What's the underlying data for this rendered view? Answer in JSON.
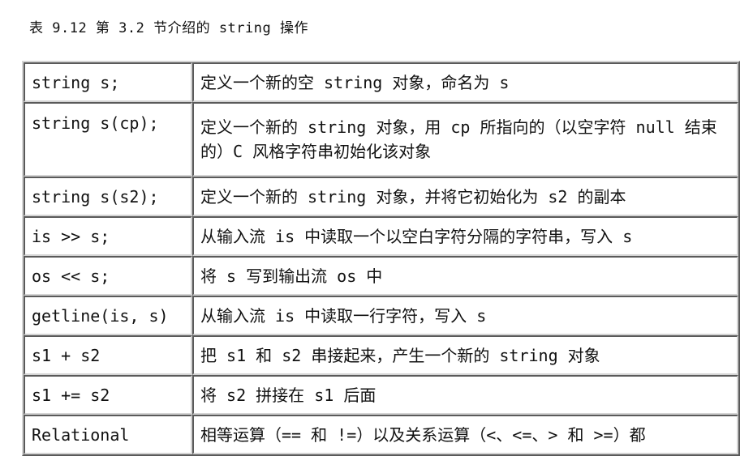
{
  "caption": "表 9.12 第 3.2 节介绍的 string 操作",
  "rows": [
    {
      "op": "string s;",
      "desc": "定义一个新的空 string 对象，命名为 s"
    },
    {
      "op": "string s(cp);",
      "desc": "定义一个新的 string 对象，用 cp 所指向的（以空字符 null 结束的）C 风格字符串初始化该对象"
    },
    {
      "op": "string s(s2);",
      "desc": "定义一个新的 string 对象，并将它初始化为 s2 的副本"
    },
    {
      "op": "is >> s;",
      "desc": "从输入流 is 中读取一个以空白字符分隔的字符串，写入 s"
    },
    {
      "op": "os << s;",
      "desc": "将 s 写到输出流 os 中"
    },
    {
      "op": "getline(is, s)",
      "desc": "从输入流 is 中读取一行字符，写入 s"
    },
    {
      "op": "s1 + s2",
      "desc": "把 s1 和 s2 串接起来，产生一个新的 string 对象"
    },
    {
      "op": "s1 += s2",
      "desc": "将 s2 拼接在 s1 后面"
    },
    {
      "op": "Relational",
      "desc": "相等运算（== 和 !=）以及关系运算（<、<=、> 和 >=）都"
    }
  ]
}
